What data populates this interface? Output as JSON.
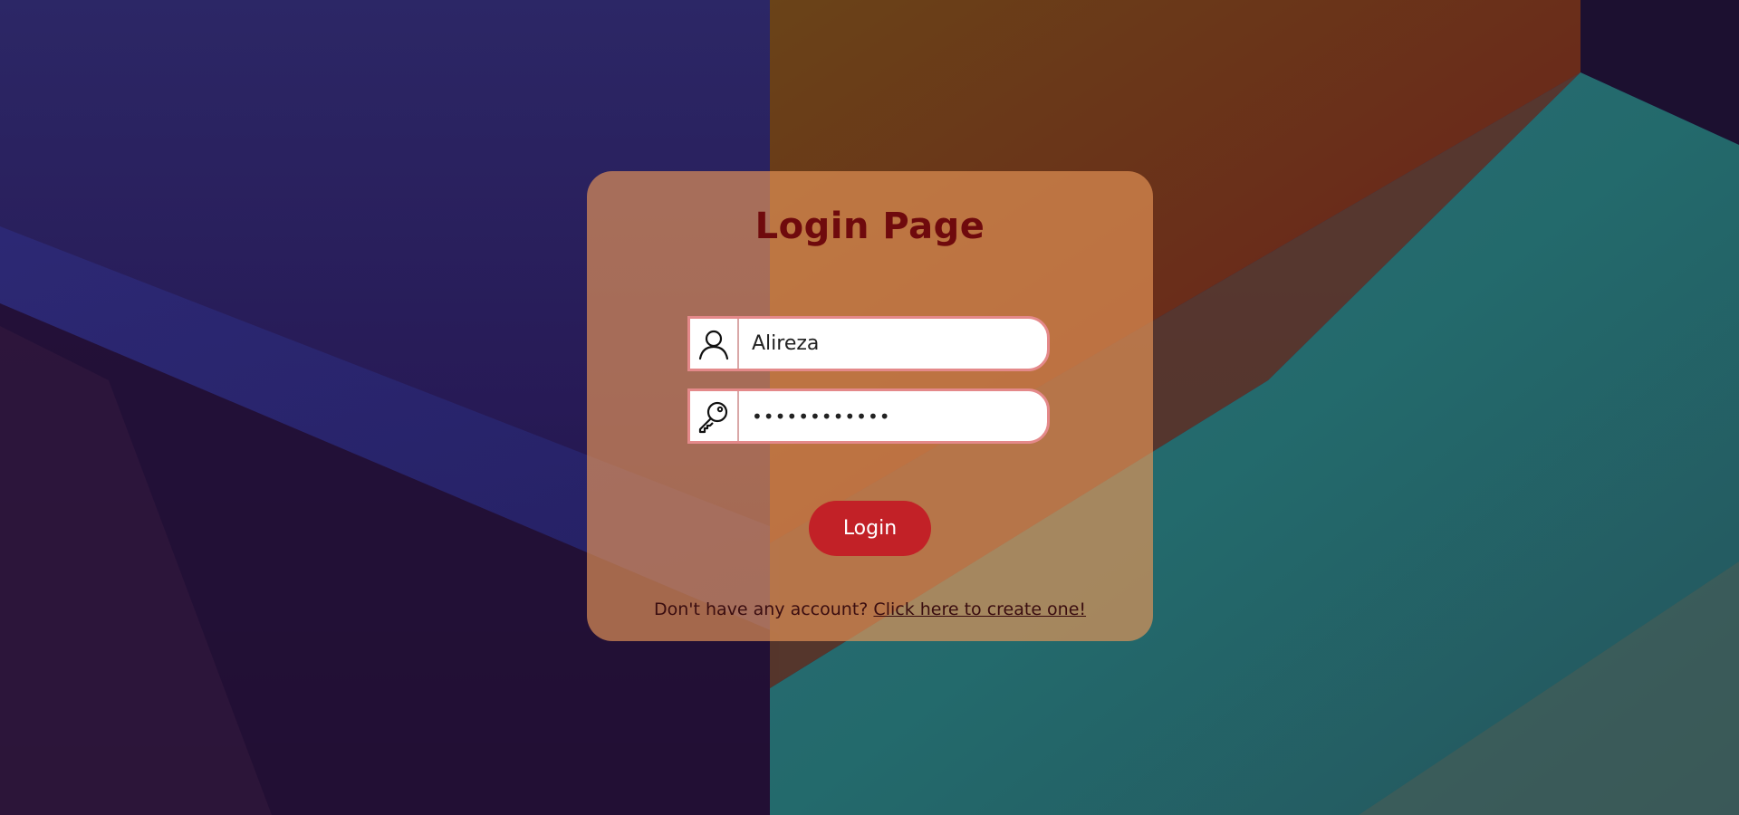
{
  "page": {
    "title": "Login Page"
  },
  "form": {
    "username": {
      "value": "Alireza",
      "icon": "user-icon"
    },
    "password": {
      "value": "••••••••••••",
      "icon": "key-icon"
    },
    "login_label": "Login"
  },
  "footer": {
    "prompt": "Don't have any account?",
    "link_text": "Click here to create one!"
  },
  "colors": {
    "title": "#6f0a0d",
    "button": "#c22127",
    "field_border": "#e4898a",
    "card": "#e89658"
  }
}
